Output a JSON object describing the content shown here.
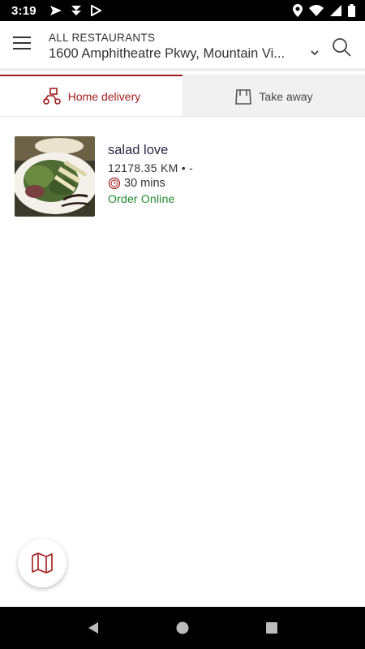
{
  "status_bar": {
    "time": "3:19"
  },
  "header": {
    "title": "ALL RESTAURANTS",
    "address": "1600 Amphitheatre Pkwy, Mountain Vi..."
  },
  "tabs": [
    {
      "label": "Home delivery",
      "active": true
    },
    {
      "label": "Take away",
      "active": false
    }
  ],
  "restaurants": [
    {
      "name": "salad love",
      "distance": "12178.35 KM • -",
      "delivery_time": "30 mins",
      "status": "Order Online"
    }
  ],
  "colors": {
    "accent": "#a11c1c",
    "online_green": "#1e8a2f"
  },
  "icons": {
    "menu": "hamburger-menu-icon",
    "search": "search-icon",
    "delivery": "scooter-icon",
    "takeaway": "bag-icon",
    "timer": "timer-icon",
    "map": "map-icon"
  }
}
